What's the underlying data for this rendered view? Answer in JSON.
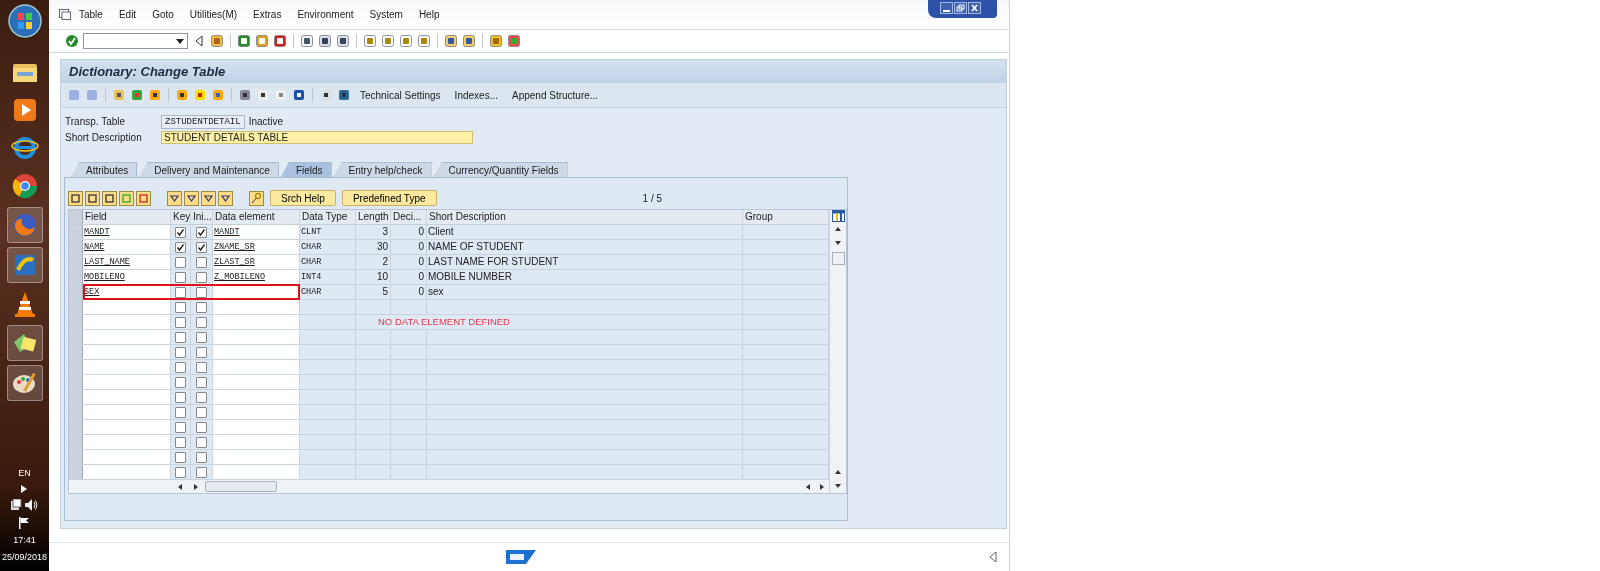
{
  "menu": [
    "Table",
    "Edit",
    "Goto",
    "Utilities(M)",
    "Extras",
    "Environment",
    "System",
    "Help"
  ],
  "title": "Dictionary: Change Table",
  "app_toolbar": {
    "buttons": [
      "Technical Settings",
      "Indexes...",
      "Append Structure..."
    ]
  },
  "header": {
    "table_label": "Transp. Table",
    "table_name": "ZSTUDENTDETAIL",
    "status": "Inactive",
    "description_label": "Short Description",
    "description": "STUDENT DETAILS TABLE"
  },
  "tabs": [
    {
      "label": "Attributes",
      "selected": false
    },
    {
      "label": "Delivery and Maintenance",
      "selected": false
    },
    {
      "label": "Fields",
      "selected": true
    },
    {
      "label": "Entry help/check",
      "selected": false
    },
    {
      "label": "Currency/Quantity Fields",
      "selected": false
    }
  ],
  "table_toolbar": {
    "buttons": [
      "Srch Help",
      "Predefined Type"
    ],
    "counter": "1 / 5"
  },
  "columns": [
    "Field",
    "Key",
    "Ini...",
    "Data element",
    "Data Type",
    "Length",
    "Deci...",
    "Short Description",
    "Group"
  ],
  "rows": [
    {
      "field": "MANDT",
      "key": true,
      "initial": true,
      "data_element": "MANDT",
      "data_type": "CLNT",
      "length": "3",
      "decimals": "0",
      "description": "Client",
      "highlighted": false
    },
    {
      "field": "NAME",
      "key": true,
      "initial": true,
      "data_element": "ZNAME_SR",
      "data_type": "CHAR",
      "length": "30",
      "decimals": "0",
      "description": "NAME OF STUDENT",
      "highlighted": false
    },
    {
      "field": "LAST_NAME",
      "key": false,
      "initial": false,
      "data_element": "ZLAST_SR",
      "data_type": "CHAR",
      "length": "2",
      "decimals": "0",
      "description": "LAST NAME FOR STUDENT",
      "highlighted": false
    },
    {
      "field": "MOBILENO",
      "key": false,
      "initial": false,
      "data_element": "Z_MOBILENO",
      "data_type": "INT4",
      "length": "10",
      "decimals": "0",
      "description": "MOBILE NUMBER",
      "highlighted": false
    },
    {
      "field": "SEX",
      "key": false,
      "initial": false,
      "data_type": "CHAR",
      "length": "5",
      "decimals": "0",
      "description": "sex",
      "highlighted": true
    }
  ],
  "blank_rows": [
    {
      "key": false,
      "initial": false
    },
    {
      "key": false,
      "initial": false,
      "note": "NO DATA ELEMENT DEFINED"
    },
    {
      "key": false,
      "initial": false
    },
    {
      "key": false,
      "initial": false
    },
    {
      "key": false,
      "initial": false
    },
    {
      "key": false,
      "initial": false
    },
    {
      "key": false,
      "initial": false
    },
    {
      "key": false,
      "initial": false
    },
    {
      "key": false,
      "initial": false
    },
    {
      "key": false,
      "initial": false
    },
    {
      "key": false,
      "initial": false
    },
    {
      "key": false,
      "initial": false
    }
  ],
  "taskbar": {
    "language": "EN",
    "time": "17:41",
    "date": "25/09/2018"
  }
}
